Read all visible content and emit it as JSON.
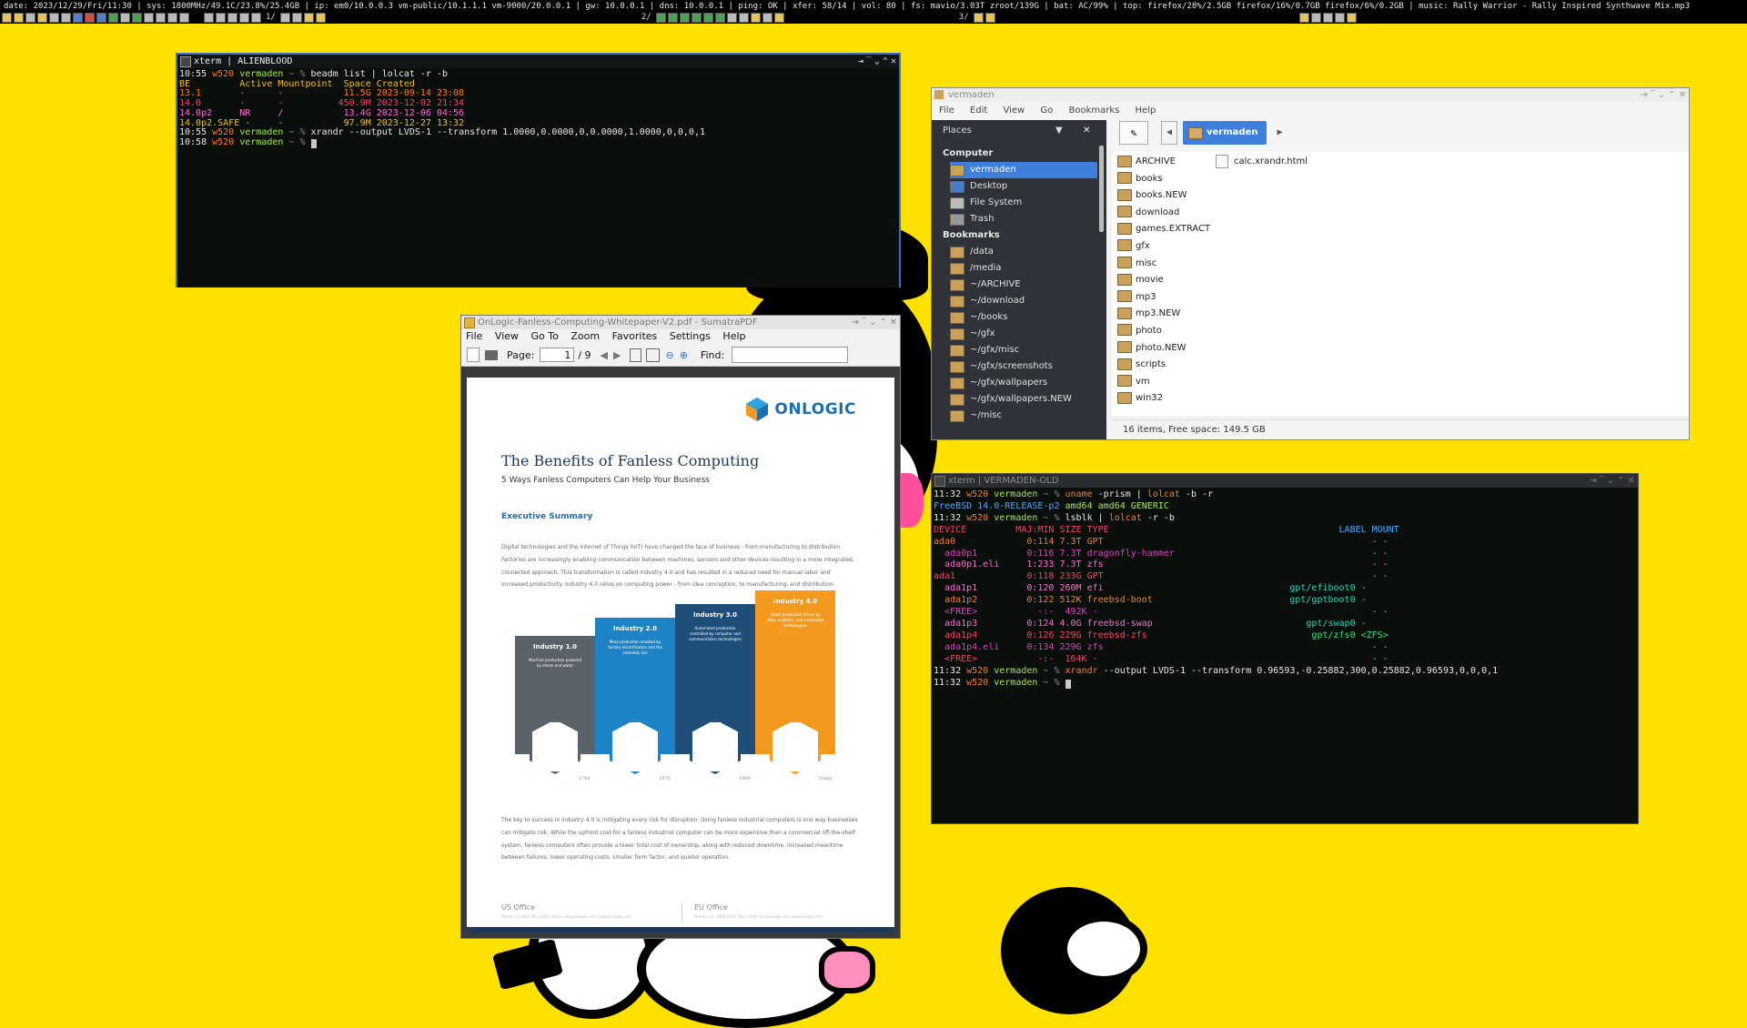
{
  "topbar": {
    "status_line": "date: 2023/12/29/Fri/11:30  |  sys: 1800MHz/49.1C/23.8%/25.4GB  |  ip: em0/10.0.0.3 vm-public/10.1.1.1 vm-9000/20.0.0.1  |  gw: 10.0.0.1  |  dns: 10.0.0.1  |  ping: OK  |  xfer: 58/14  |  vol: 80  |  fs: mavio/3.03T zroot/139G  |  bat: AC/99%  |  top: firefox/28%/2.5GB firefox/16%/0.7GB firefox/6%/0.2GB  |  music: Rally Warrior - Rally Inspired Synthwave Mix.mp3",
    "workspace_1": "1/",
    "workspace_2": "2/",
    "workspace_3": "3/"
  },
  "term1": {
    "title": "xterm | ALIENBLOOD",
    "lines": [
      [
        {
          "t": "10:55 ",
          "c": "c-w"
        },
        {
          "t": "w520 ",
          "c": "c-o"
        },
        {
          "t": "vermaden ",
          "c": "c-g"
        },
        {
          "t": "~ % ",
          "c": "c-gr"
        },
        {
          "t": "beadm list | lolcat -r -b",
          "c": "c-w"
        }
      ],
      [
        {
          "t": "BE         Active Mountpoint  Space Created",
          "c": "c-y"
        }
      ],
      [
        {
          "t": "13.1       -      -           11.5G 2023-09-14 23:08",
          "c": "c-o"
        }
      ],
      [
        {
          "t": "14.0       -      -          450.9M 2023-12-02 21:34",
          "c": "c-r"
        }
      ],
      [
        {
          "t": "14.0p2     NR     /           13.4G 2023-12-06 04:56",
          "c": "c-pk"
        }
      ],
      [
        {
          "t": "14.0p2.SAFE -     -           97.9M 2023-12-27 13:32",
          "c": "c-y"
        }
      ],
      [
        {
          "t": "10:55 ",
          "c": "c-w"
        },
        {
          "t": "w520 ",
          "c": "c-o"
        },
        {
          "t": "vermaden ",
          "c": "c-g"
        },
        {
          "t": "~ % ",
          "c": "c-gr"
        },
        {
          "t": "xrandr --output LVDS-1 --transform 1.0000,0.0000,0,0.0000,1.0000,0,0,0,1",
          "c": "c-w"
        }
      ],
      [
        {
          "t": "10:58 ",
          "c": "c-w"
        },
        {
          "t": "w520 ",
          "c": "c-o"
        },
        {
          "t": "vermaden ",
          "c": "c-g"
        },
        {
          "t": "~ % ",
          "c": "c-gr"
        },
        {
          "t": "",
          "c": "cursor"
        }
      ]
    ]
  },
  "sumatra": {
    "title": "OnLogic-Fanless-Computing-Whitepaper-V2.pdf - SumatraPDF",
    "menu": [
      "File",
      "View",
      "Go To",
      "Zoom",
      "Favorites",
      "Settings",
      "Help"
    ],
    "page_label": "Page:",
    "page_value": "1",
    "page_total": "/ 9",
    "find_label": "Find:",
    "doc": {
      "brand": "ONLOGIC",
      "heading": "The Benefits of Fanless Computing",
      "subheading": "5 Ways Fanless Computers Can Help Your Business",
      "section": "Executive Summary",
      "para1": "Digital technologies and the Internet of Things (IoT) have changed the face of business - from manufacturing to distribution. Factories are increasingly enabling communication between machines, sensors and other devices resulting in a more integrated, connected approach. This transformation is called Industry 4.0 and has resulted in a reduced need for manual labor and increased productivity. Industry 4.0 relies on computing power - from idea conception, to manufacturing, and distribution.",
      "stages": [
        {
          "name": "Industry 1.0",
          "desc": "Machine production powered by steam and water",
          "year": "1784",
          "color": "#5b6168"
        },
        {
          "name": "Industry 2.0",
          "desc": "Mass production enabled by factory electrification and the assembly line",
          "year": "1870",
          "color": "#1c84c6"
        },
        {
          "name": "Industry 3.0",
          "desc": "Automated production controlled by computer and communication technologies",
          "year": "1969",
          "color": "#1f4e79"
        },
        {
          "name": "Industry 4.0",
          "desc": "Smart production driven by data, analytics, and networked technologies",
          "year": "Today",
          "color": "#f39a1e"
        }
      ],
      "para2": "The key to success in Industry 4.0 is mitigating every risk for disruption. Using fanless industrial computers is one way businesses can mitigate risk. While the upfront cost for a fanless industrial computer can be more expensive than a commercial off-the-shelf system, fanless computers often provide a lower total cost of ownership, along with reduced downtime, increased meantime between failures, lower operating costs, smaller form factor, and quieter operation.",
      "us_office": "US Office",
      "us_contact": "Phone +1 (802) 861-2300  |  Email info@onlogic.com  |  www.onlogic.com",
      "eu_office": "EU Office",
      "eu_contact": "Phone +31 (0)88 5200 700  |  Email info@onlogic.eu  |  www.onlogic.com"
    }
  },
  "filemanager": {
    "title": "vermaden",
    "menu": [
      "File",
      "Edit",
      "View",
      "Go",
      "Bookmarks",
      "Help"
    ],
    "places_label": "Places",
    "location": "vermaden",
    "sections": [
      {
        "header": "Computer",
        "items": [
          "vermaden",
          "Desktop",
          "File System",
          "Trash"
        ]
      },
      {
        "header": "Bookmarks",
        "items": [
          "/data",
          "/media",
          "~/ARCHIVE",
          "~/download",
          "~/books",
          "~/gfx",
          "~/gfx/misc",
          "~/gfx/screenshots",
          "~/gfx/wallpapers",
          "~/gfx/wallpapers.NEW",
          "~/misc"
        ]
      }
    ],
    "selected_place": "vermaden",
    "folders": [
      "ARCHIVE",
      "books",
      "books.NEW",
      "download",
      "games.EXTRACT",
      "gfx",
      "misc",
      "movie",
      "mp3",
      "mp3.NEW",
      "photo",
      "photo.NEW",
      "scripts",
      "vm",
      "win32"
    ],
    "files": [
      "calc.xrandr.html"
    ],
    "statusbar": "16 items, Free space: 149.5 GB"
  },
  "term2": {
    "title": "xterm | VERMADEN-OLD",
    "lines": [
      [
        {
          "t": "11:32 ",
          "c": "c-w"
        },
        {
          "t": "w520 ",
          "c": "c-o"
        },
        {
          "t": "vermaden ",
          "c": "c-g"
        },
        {
          "t": "~ % ",
          "c": "c-gr"
        },
        {
          "t": "uname ",
          "c": "c-o"
        },
        {
          "t": "-prism | ",
          "c": "c-w"
        },
        {
          "t": "lolcat ",
          "c": "c-o"
        },
        {
          "t": "-b -r",
          "c": "c-w"
        }
      ],
      [
        {
          "t": "FreeBSD 14.0-RELEASE-p2 ",
          "c": "c-b"
        },
        {
          "t": "amd64 amd64 GENERIC",
          "c": "c-g"
        }
      ],
      [
        {
          "t": "11:32 ",
          "c": "c-w"
        },
        {
          "t": "w520 ",
          "c": "c-o"
        },
        {
          "t": "vermaden ",
          "c": "c-g"
        },
        {
          "t": "~ % ",
          "c": "c-gr"
        },
        {
          "t": "lsblk | ",
          "c": "c-w"
        },
        {
          "t": "lolcat ",
          "c": "c-o"
        },
        {
          "t": "-r -b",
          "c": "c-w"
        }
      ],
      [
        {
          "t": "DEVICE         MAJ:MIN SIZE TYPE                                          ",
          "c": "c-r"
        },
        {
          "t": "LABEL MOUNT",
          "c": "c-b"
        }
      ],
      [
        {
          "t": "ada0             0:114 7.3T GPT                                                 ",
          "c": "c-o"
        },
        {
          "t": "- -",
          "c": "c-lg"
        }
      ],
      [
        {
          "t": "  ada0p1         0:116 7.3T dragonfly-hammer                                    ",
          "c": "c-p"
        },
        {
          "t": "- -",
          "c": "c-lg"
        }
      ],
      [
        {
          "t": "  ada0p1.eli     1:233 7.3T zfs                                                 ",
          "c": "c-pk"
        },
        {
          "t": "- -",
          "c": "c-lg"
        }
      ],
      [
        {
          "t": "ada1             0:118 233G GPT                                                 ",
          "c": "c-r"
        },
        {
          "t": "- -",
          "c": "c-lg"
        }
      ],
      [
        {
          "t": "  ada1p1         0:120 260M efi                                  ",
          "c": "c-pk"
        },
        {
          "t": "gpt/efiboot0 -",
          "c": "c-c"
        }
      ],
      [
        {
          "t": "  ada1p2         0:122 512K freebsd-boot                         ",
          "c": "c-o"
        },
        {
          "t": "gpt/gptboot0 -",
          "c": "c-c"
        }
      ],
      [
        {
          "t": "  <FREE>           -:-  492K -                                                  ",
          "c": "c-p"
        },
        {
          "t": "- -",
          "c": "c-lg"
        }
      ],
      [
        {
          "t": "  ada1p3         0:124 4.0G freebsd-swap                            ",
          "c": "c-pk"
        },
        {
          "t": "gpt/swap0 -",
          "c": "c-c"
        }
      ],
      [
        {
          "t": "  ada1p4         0:126 229G freebsd-zfs                              ",
          "c": "c-r"
        },
        {
          "t": "gpt/zfs0 <ZFS>",
          "c": "c-lg"
        }
      ],
      [
        {
          "t": "  ada1p4.eli     0:134 229G zfs                                                 ",
          "c": "c-p"
        },
        {
          "t": "- -",
          "c": "c-lg"
        }
      ],
      [
        {
          "t": "  <FREE>           -:-  164K -                                                  ",
          "c": "c-r"
        },
        {
          "t": "- -",
          "c": "c-lg"
        }
      ],
      [
        {
          "t": "11:32 ",
          "c": "c-w"
        },
        {
          "t": "w520 ",
          "c": "c-o"
        },
        {
          "t": "vermaden ",
          "c": "c-g"
        },
        {
          "t": "~ % ",
          "c": "c-gr"
        },
        {
          "t": "xrandr ",
          "c": "c-o"
        },
        {
          "t": "--output LVDS-1 --transform 0.96593,-0.25882,300,0.25882,0.96593,0,0,0,1",
          "c": "c-w"
        }
      ],
      [
        {
          "t": "11:32 ",
          "c": "c-w"
        },
        {
          "t": "w520 ",
          "c": "c-o"
        },
        {
          "t": "vermaden ",
          "c": "c-g"
        },
        {
          "t": "~ % ",
          "c": "c-gr"
        },
        {
          "t": "",
          "c": "cursor"
        }
      ]
    ]
  },
  "colors": {
    "desktop": "#ffe100",
    "term_bg": "#0b0f0c",
    "fm_sidebar": "#2f3339",
    "accent": "#3d7fdb"
  }
}
